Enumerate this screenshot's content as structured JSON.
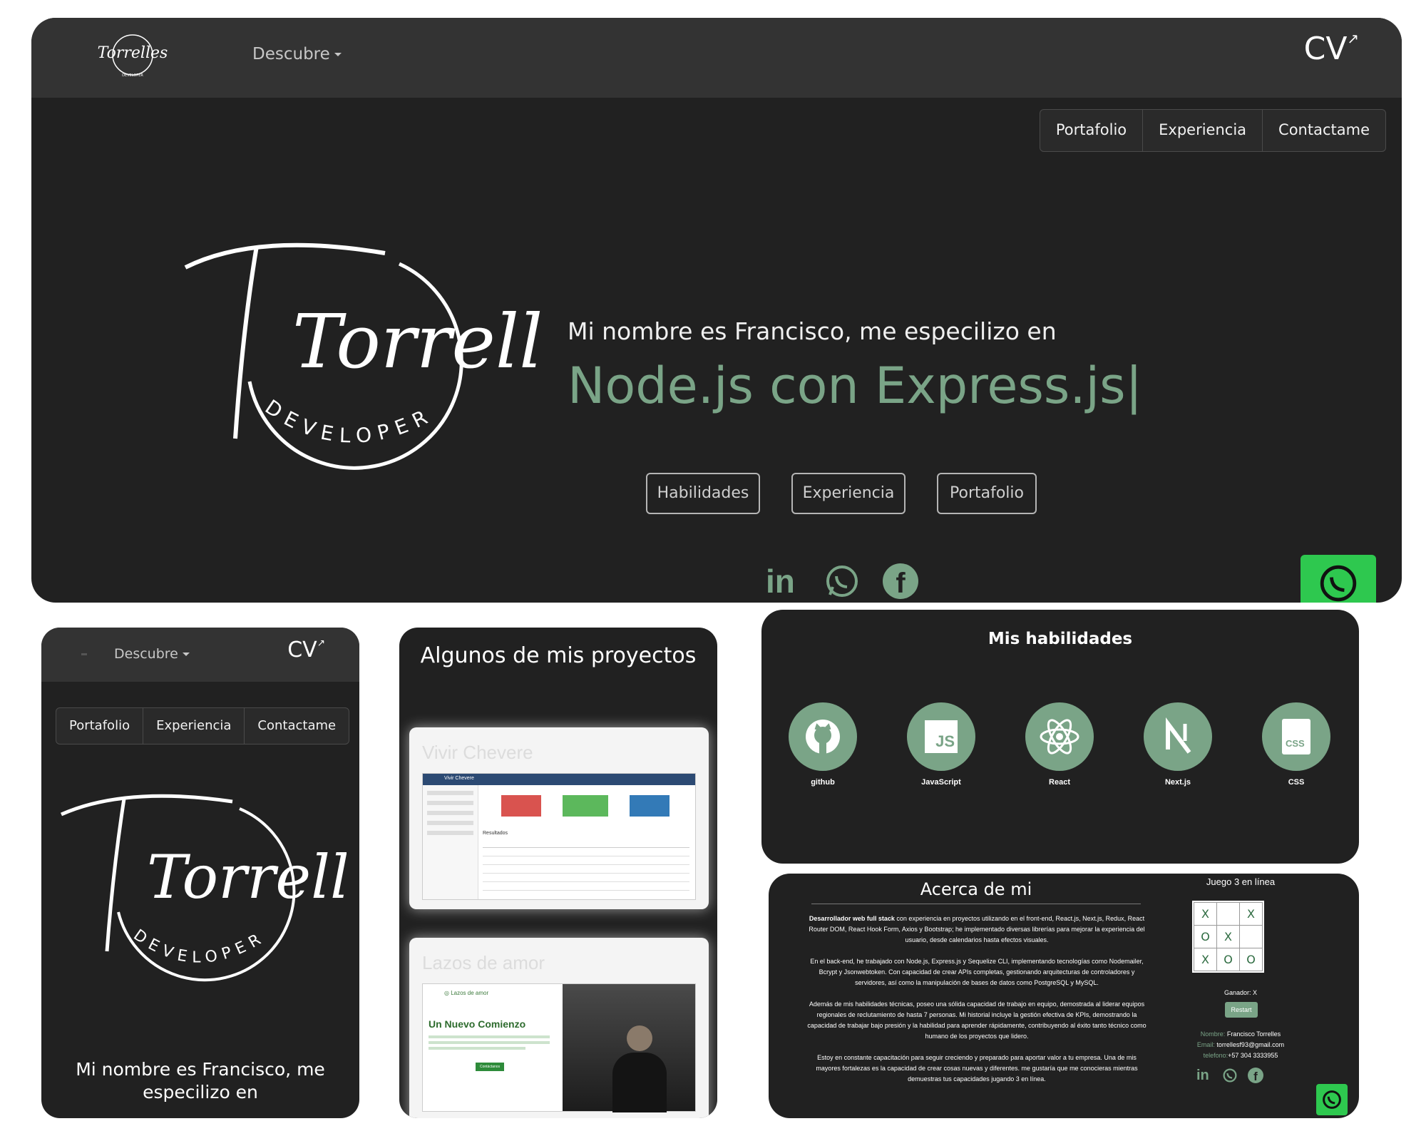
{
  "desktop": {
    "nav": {
      "dropdown_label": "Descubre",
      "cv_label": "CV"
    },
    "tabs": [
      "Portafolio",
      "Experiencia",
      "Contactame"
    ],
    "logo": {
      "script_text": "Torrelles",
      "arc_text": "DEVELOPER",
      "mini_sub": "DEVELOPER"
    },
    "hero": {
      "intro": "Mi nombre es Francisco, me especilizo en",
      "typed": "Node.js con Express.js|"
    },
    "buttons": [
      "Habilidades",
      "Experiencia",
      "Portafolio"
    ],
    "social_icons": [
      "linkedin-icon",
      "whatsapp-icon",
      "facebook-icon"
    ]
  },
  "mobile": {
    "nav": {
      "dropdown_label": "Descubre",
      "cv_label": "CV"
    },
    "tabs": [
      "Portafolio",
      "Experiencia",
      "Contactame"
    ],
    "logo": {
      "script_text": "Torrelles",
      "arc_text": "DEVELOPER"
    },
    "intro": "Mi nombre es Francisco, me especilizo en"
  },
  "projects": {
    "title": "Algunos de mis proyectos",
    "items": [
      {
        "name": "Vivir Chevere",
        "app_title": "Vivir Chevere",
        "stat_colors": [
          "#d9534f",
          "#5cb85c",
          "#337ab7"
        ],
        "results_label": "Resultados"
      },
      {
        "name": "Lazos de amor",
        "brand": "Lazos de amor",
        "headline": "Un Nuevo Comienzo",
        "cta": "Contáctanos"
      }
    ]
  },
  "skills": {
    "title": "Mis habilidades",
    "items": [
      {
        "label": "github",
        "icon": "github-icon"
      },
      {
        "label": "JavaScript",
        "icon": "javascript-icon"
      },
      {
        "label": "React",
        "icon": "react-icon"
      },
      {
        "label": "Next.js",
        "icon": "nextjs-icon"
      },
      {
        "label": "CSS",
        "icon": "css-icon"
      }
    ]
  },
  "about": {
    "title": "Acerca de mi",
    "p1_bold": "Desarrollador web full stack",
    "p1": " con experiencia en proyectos utilizando en el front-end, React.js, Next.js, Redux, React Router DOM, React Hook Form, Axios y Bootstrap; he implementado diversas librerías para mejorar la experiencia del usuario, desde calendarios hasta efectos visuales.",
    "p2": "En el back-end, he trabajado con Node.js, Express.js y Sequelize CLI, implementando tecnologías como Nodemailer, Bcrypt y Jsonwebtoken. Con capacidad de crear APIs completas, gestionando arquitecturas de controladores y servidores, así como la manipulación de bases de datos como PostgreSQL y MySQL.",
    "p3": "Además de mis habilidades técnicas, poseo una sólida capacidad de trabajo en equipo, demostrada al liderar equipos regionales de reclutamiento de hasta 7 personas. Mi historial incluye la gestión efectiva de KPIs, demostrando la capacidad de trabajar bajo presión y la habilidad para aprender rápidamente, contribuyendo al éxito tanto técnico como humano de los proyectos que lidero.",
    "p4": "Estoy en constante capacitación para seguir creciendo y preparado para aportar valor a tu empresa. Una de mis mayores fortalezas es la capacidad de crear cosas nuevas y diferentes. me gustaría que me conocieras mientras demuestras tus capacidades jugando 3 en línea."
  },
  "game": {
    "title": "Juego 3 en línea",
    "board": [
      "X",
      "",
      "X",
      "O",
      "X",
      "",
      "X",
      "O",
      "O"
    ],
    "winner": "Ganador: X",
    "restart": "Restart",
    "contact": {
      "name_label": "Nombre:",
      "name": "Francisco Torrelles",
      "email_label": "Email:",
      "email": "torrellesf93@gmail.com",
      "phone_label": "telefono:",
      "phone": "+57 304 3333955"
    }
  },
  "colors": {
    "accent": "#7aa487",
    "dark": "#212121",
    "topbar": "#333333",
    "whatsapp": "#2ec84f"
  }
}
